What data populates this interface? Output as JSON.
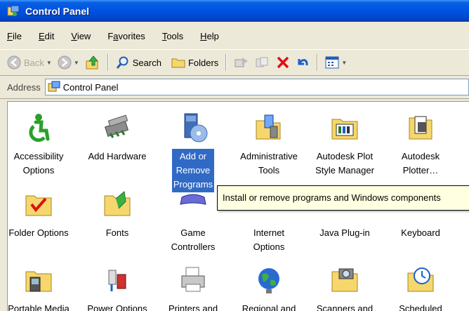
{
  "window": {
    "title": "Control Panel"
  },
  "menu": [
    {
      "key": "F",
      "rest": "ile"
    },
    {
      "key": "E",
      "rest": "dit"
    },
    {
      "key": "V",
      "rest": "iew"
    },
    {
      "pre": "F",
      "key": "a",
      "rest": "vorites"
    },
    {
      "key": "T",
      "rest": "ools"
    },
    {
      "key": "H",
      "rest": "elp"
    }
  ],
  "toolbar": {
    "back_label": "Back",
    "search_label": "Search",
    "folders_label": "Folders",
    "icons": {
      "back": "back-arrow-icon",
      "forward": "forward-arrow-icon",
      "up": "up-folder-icon",
      "search": "search-icon",
      "folders": "folders-icon",
      "move_to": "move-to-icon",
      "copy_to": "copy-to-icon",
      "delete": "delete-x-icon",
      "undo": "undo-icon",
      "views": "views-icon"
    }
  },
  "address": {
    "label": "Address",
    "value": "Control Panel"
  },
  "items": [
    {
      "name": "accessibility-options",
      "label": "Accessibility\nOptions",
      "icon": "accessibility-icon"
    },
    {
      "name": "add-hardware",
      "label": "Add Hardware",
      "icon": "add-hardware-icon"
    },
    {
      "name": "add-remove-programs",
      "label": "Add or\nRemove\nPrograms",
      "icon": "add-remove-programs-icon",
      "selected": true
    },
    {
      "name": "administrative-tools",
      "label": "Administrative\nTools",
      "icon": "administrative-tools-icon"
    },
    {
      "name": "autodesk-plot-style-manager",
      "label": "Autodesk Plot\nStyle Manager",
      "icon": "plot-style-folder-icon"
    },
    {
      "name": "autodesk-plotter",
      "label": "Autodesk\nPlotter…",
      "icon": "plotter-icon"
    },
    {
      "name": "folder-options",
      "label": "Folder Options",
      "icon": "folder-options-icon"
    },
    {
      "name": "fonts",
      "label": "Fonts",
      "icon": "fonts-folder-icon"
    },
    {
      "name": "game-controllers",
      "label": "Game\nControllers",
      "icon": "gamepad-icon"
    },
    {
      "name": "internet-options",
      "label": "Internet\nOptions",
      "icon": "internet-icon"
    },
    {
      "name": "java-plugin",
      "label": "Java Plug-in",
      "icon": "java-icon"
    },
    {
      "name": "keyboard",
      "label": "Keyboard",
      "icon": "keyboard-icon"
    },
    {
      "name": "portable-media",
      "label": "Portable Media",
      "icon": "portable-media-icon"
    },
    {
      "name": "power-options",
      "label": "Power Options",
      "icon": "power-options-icon"
    },
    {
      "name": "printers",
      "label": "Printers and",
      "icon": "printer-icon"
    },
    {
      "name": "regional",
      "label": "Regional and",
      "icon": "globe-icon"
    },
    {
      "name": "scanners",
      "label": "Scanners and",
      "icon": "scanner-camera-icon"
    },
    {
      "name": "scheduled",
      "label": "Scheduled",
      "icon": "scheduled-tasks-icon"
    }
  ],
  "tooltip": {
    "text": "Install or remove programs and Windows components"
  },
  "colors": {
    "titlebar": "#0054e3",
    "selection": "#316ac5",
    "tooltip_bg": "#ffffe1",
    "chrome": "#ece9d8"
  }
}
